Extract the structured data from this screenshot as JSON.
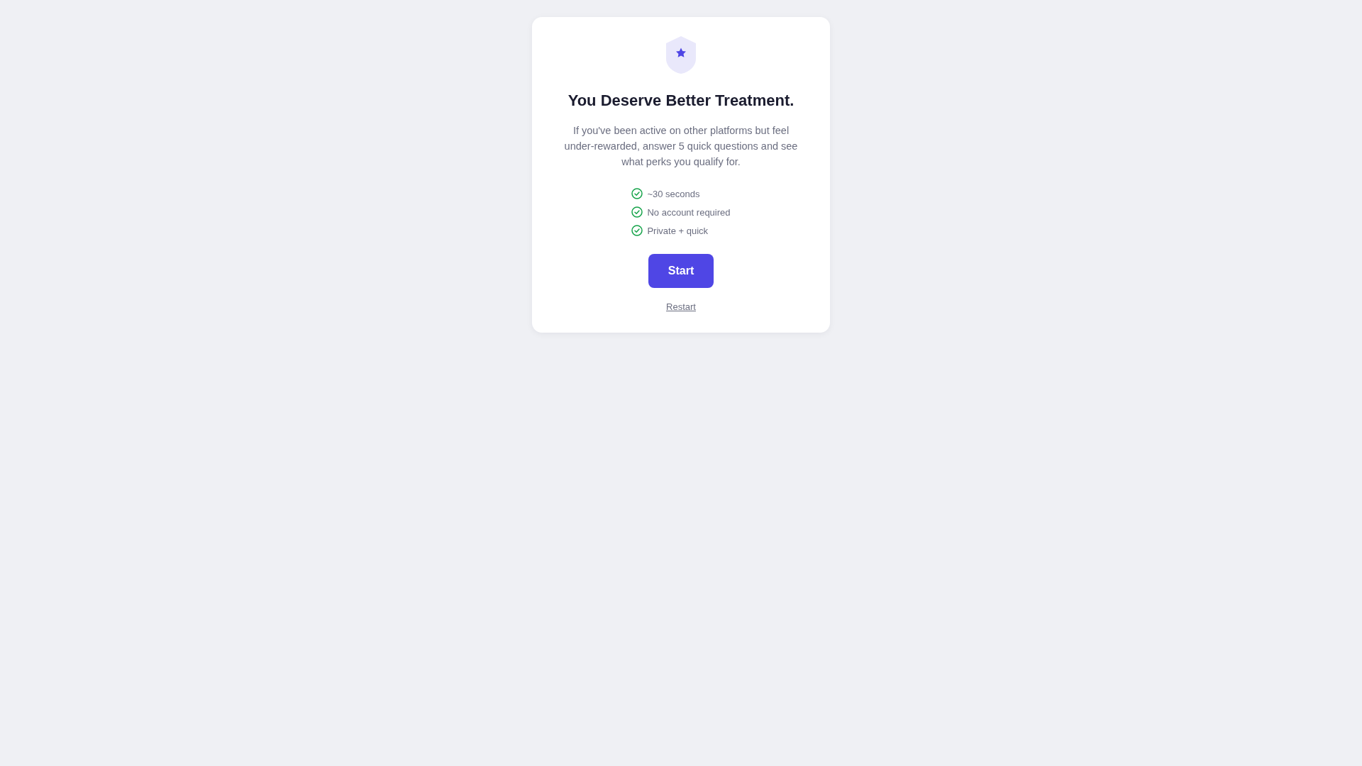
{
  "card": {
    "title": "You Deserve Better Treatment.",
    "description": "If you've been active on other platforms but feel under-rewarded, answer 5 quick questions and see what perks you qualify for.",
    "features": [
      "~30 seconds",
      "No account required",
      "Private + quick"
    ],
    "primary_button": "Start",
    "link": "Restart"
  }
}
